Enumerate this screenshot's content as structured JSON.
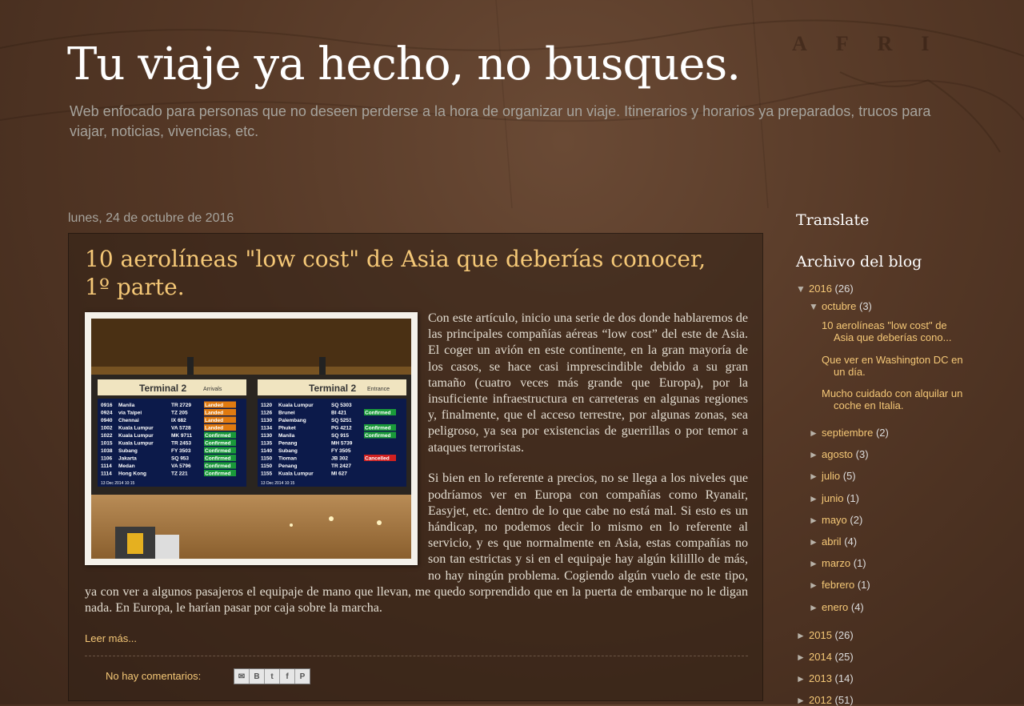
{
  "header": {
    "title": "Tu viaje ya hecho, no busques.",
    "description": "Web enfocado para personas que no deseen perderse a la hora de organizar un viaje. Itinerarios y horarios ya preparados, trucos para viajar, noticias, vivencias, etc.",
    "map_letters": "AFRI"
  },
  "post": {
    "date": "lunes, 24 de octubre de 2016",
    "title": "10 aerolíneas \"low cost\" de Asia que deberías conocer, 1º parte.",
    "paragraph1": "Con este artículo, inicio una serie de dos donde hablaremos de las principales compañías aéreas “low cost” del este de Asia. El coger un avión en este continente, en la gran mayoría de los casos, se hace casi imprescindible debido a su gran tamaño (cuatro veces más grande que Europa), por la insuficiente infraestructura en carreteras en algunas regiones y, finalmente, que el acceso terrestre, por algunas zonas, sea peligroso, ya sea por existencias de guerrillas o por temor a ataques terroristas.",
    "paragraph2": "Si bien en lo referente a precios, no se llega a los niveles que podríamos ver en Europa con compañías como Ryanair, Easyjet, etc. dentro de lo que cabe no está mal. Si esto es un hándicap, no podemos decir lo mismo en lo referente al servicio, y es que normalmente en Asia, estas compañías no son tan estrictas y si en el equipaje hay algún kililllo de más, no hay ningún problema. Cogiendo algún vuelo de este tipo, ya con ver a algunos pasajeros el equipaje de mano que llevan, me quedo sorprendido que en la puerta de embarque no le digan nada. En Europa, le harían pasar por caja sobre la marcha.",
    "read_more": "Leer más...",
    "comments": "No hay comentarios:",
    "share_icons": [
      "email-icon",
      "blogger-icon",
      "twitter-icon",
      "facebook-icon",
      "pinterest-icon"
    ],
    "image": {
      "board_left_title": "Terminal 2",
      "board_left_tag": "Arrivals",
      "board_right_title": "Terminal 2",
      "board_right_tag": "Entrance",
      "left_rows": [
        [
          "0916",
          "Manila",
          "TR 2729",
          "Landed"
        ],
        [
          "0924",
          "via Taipei",
          "TZ 205",
          "Landed"
        ],
        [
          "0940",
          "Chennai",
          "IX 682",
          "Landed"
        ],
        [
          "1002",
          "Kuala Lumpur",
          "VA 5728",
          "Landed"
        ],
        [
          "1022",
          "Kuala Lumpur",
          "MK 9711",
          "Confirmed"
        ],
        [
          "1015",
          "Kuala Lumpur",
          "TR 2453",
          "Confirmed"
        ],
        [
          "1038",
          "Subang",
          "FY 3503",
          "Confirmed"
        ],
        [
          "1106",
          "Jakarta",
          "SQ 953",
          "Confirmed"
        ],
        [
          "1114",
          "Medan",
          "VA 5796",
          "Confirmed"
        ],
        [
          "1114",
          "Hong Kong",
          "TZ 221",
          "Confirmed"
        ]
      ],
      "right_rows": [
        [
          "1120",
          "Kuala Lumpur",
          "SQ 5303",
          ""
        ],
        [
          "1126",
          "Brunei",
          "BI 421",
          "Confirmed"
        ],
        [
          "1130",
          "Palembang",
          "SQ 5251",
          ""
        ],
        [
          "1134",
          "Phuket",
          "PG 4212",
          "Confirmed"
        ],
        [
          "1130",
          "Manila",
          "SQ 915",
          "Confirmed"
        ],
        [
          "1135",
          "Penang",
          "MH 5739",
          ""
        ],
        [
          "1140",
          "Subang",
          "FY 3505",
          ""
        ],
        [
          "1150",
          "Tioman",
          "JB 302",
          "Cancelled"
        ],
        [
          "1150",
          "Penang",
          "TR 2427",
          ""
        ],
        [
          "1155",
          "Kuala Lumpur",
          "MI 627",
          ""
        ]
      ],
      "board_date": "13 Dec 2014  10:15"
    }
  },
  "sidebar": {
    "translate_heading": "Translate",
    "archive_heading": "Archivo del blog",
    "year_2016": {
      "toggle": "▼",
      "label": "2016",
      "count": "(26)"
    },
    "month_oct": {
      "toggle": "▼",
      "label": "octubre",
      "count": "(3)"
    },
    "oct_posts": [
      "10 aerolíneas \"low cost\" de Asia que deberías cono...",
      "Que ver en Washington DC en un día.",
      "Mucho cuidado con alquilar un coche en Italia."
    ],
    "months": [
      {
        "toggle": "►",
        "label": "septiembre",
        "count": "(2)"
      },
      {
        "toggle": "►",
        "label": "agosto",
        "count": "(3)"
      },
      {
        "toggle": "►",
        "label": "julio",
        "count": "(5)"
      },
      {
        "toggle": "►",
        "label": "junio",
        "count": "(1)"
      },
      {
        "toggle": "►",
        "label": "mayo",
        "count": "(2)"
      },
      {
        "toggle": "►",
        "label": "abril",
        "count": "(4)"
      },
      {
        "toggle": "►",
        "label": "marzo",
        "count": "(1)"
      },
      {
        "toggle": "►",
        "label": "febrero",
        "count": "(1)"
      },
      {
        "toggle": "►",
        "label": "enero",
        "count": "(4)"
      }
    ],
    "years": [
      {
        "toggle": "►",
        "label": "2015",
        "count": "(26)"
      },
      {
        "toggle": "►",
        "label": "2014",
        "count": "(25)"
      },
      {
        "toggle": "►",
        "label": "2013",
        "count": "(14)"
      },
      {
        "toggle": "►",
        "label": "2012",
        "count": "(51)"
      }
    ]
  },
  "colors": {
    "background": "#553826",
    "title": "#ffffff",
    "link": "#f5c877",
    "post_title": "#f5c877",
    "muted_text": "#a6a39c"
  }
}
